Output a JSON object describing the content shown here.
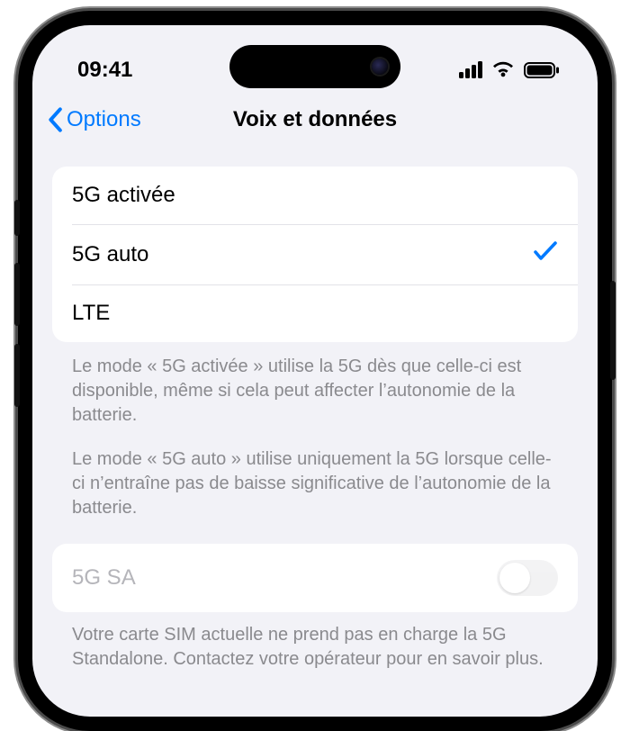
{
  "status": {
    "time": "09:41"
  },
  "nav": {
    "back": "Options",
    "title": "Voix et données"
  },
  "options": {
    "items": [
      {
        "label": "5G activée",
        "selected": false
      },
      {
        "label": "5G auto",
        "selected": true
      },
      {
        "label": "LTE",
        "selected": false
      }
    ],
    "footer1": "Le mode « 5G activée » utilise la 5G dès que celle-ci est disponible, même si cela peut affecter l’autonomie de la batterie.",
    "footer2": "Le mode « 5G auto » utilise uniquement la 5G lorsque celle-ci n’entraîne pas de baisse significative de l’autonomie de la batterie."
  },
  "sa": {
    "label": "5G SA",
    "enabled": false,
    "footer": "Votre carte SIM actuelle ne prend pas en charge la 5G Standalone. Contactez votre opérateur pour en savoir plus."
  },
  "icons": {
    "chevron_left": "chevron-left-icon",
    "cellular": "cellular-signal-icon",
    "wifi": "wifi-icon",
    "battery": "battery-icon",
    "checkmark": "checkmark-icon"
  }
}
